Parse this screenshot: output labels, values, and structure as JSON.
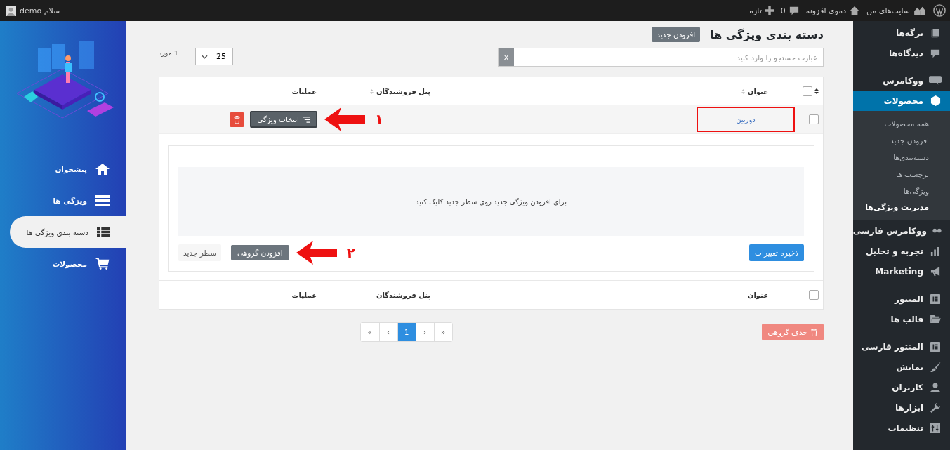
{
  "admin_bar": {
    "items": [
      {
        "kind": "wordpress"
      },
      {
        "kind": "sites",
        "label": "سایت‌های من"
      },
      {
        "kind": "home",
        "label": "دموی افزونه"
      },
      {
        "kind": "comments",
        "label": "0"
      },
      {
        "kind": "new",
        "label": "تازه"
      }
    ],
    "greeting": "سلام demo"
  },
  "admin_menu": {
    "groups": [
      [
        {
          "kind": "pages",
          "label": "برگه‌ها",
          "selected": false
        },
        {
          "kind": "comments",
          "label": "دیدگاه‌ها",
          "selected": false
        }
      ],
      [
        {
          "kind": "woo",
          "label": "ووکامرس",
          "selected": false
        },
        {
          "kind": "box",
          "label": "محصولات",
          "selected": true,
          "children": [
            {
              "label": "همه محصولات",
              "selected": false
            },
            {
              "label": "افزودن جدید",
              "selected": false
            },
            {
              "label": "دسته‌بندی‌ها",
              "selected": false
            },
            {
              "label": "برچسب ها",
              "selected": false
            },
            {
              "label": "ویژگی‌ها",
              "selected": false
            },
            {
              "label": "مدیریت ویژگی‌ها",
              "selected": true
            }
          ]
        },
        {
          "kind": "quote",
          "label": "ووکامرس فارسی",
          "selected": false
        },
        {
          "kind": "chart",
          "label": "تجربه و تحلیل",
          "selected": false
        },
        {
          "kind": "megaphone",
          "label": "Marketing",
          "selected": false
        }
      ],
      [
        {
          "kind": "elementor",
          "label": "المنتور",
          "selected": false
        },
        {
          "kind": "folder",
          "label": "قالب ها",
          "selected": false
        }
      ],
      [
        {
          "kind": "elementor",
          "label": "المنتور فارسی",
          "selected": false
        },
        {
          "kind": "brush",
          "label": "نمایش",
          "selected": false
        },
        {
          "kind": "user",
          "label": "کاربران",
          "selected": false
        },
        {
          "kind": "wrench",
          "label": "ابزارها",
          "selected": false
        },
        {
          "kind": "settings",
          "label": "تنظیمات",
          "selected": false
        }
      ]
    ]
  },
  "plugin_nav": {
    "items": [
      {
        "kind": "home",
        "label": "پیشخوان",
        "selected": false
      },
      {
        "kind": "rows",
        "label": "ویژگی ها",
        "selected": false
      },
      {
        "kind": "list",
        "label": "دسته بندی ویژگی ها",
        "selected": true
      },
      {
        "kind": "cart",
        "label": "محصولات",
        "selected": false
      }
    ]
  },
  "page": {
    "title": "دسته بندی ویژگی ها",
    "add_button": "افزودن جدید"
  },
  "search": {
    "placeholder": "عبارت جستجو را وارد کنید",
    "clear": "x"
  },
  "per_page": {
    "value": "25",
    "count": "1 مورد"
  },
  "table": {
    "select_all_checked": false,
    "footer_select_all_checked": false,
    "columns": [
      "عنوان",
      "پنل فروشندگان",
      "عملیات"
    ],
    "rows": [
      {
        "checked": false,
        "title": "دوربین",
        "highlighted": true,
        "select_button": "انتخاب ویژگی",
        "annotation": "۱",
        "expanded": true
      }
    ],
    "panel": {
      "empty_message": "برای افزودن ویژگی جدید روی سطر جدید کلیک کنید",
      "save_button": "ذخیره تغییرات",
      "bulk_add_button": "افزودن گروهی",
      "bulk_add_annotation": "۲",
      "new_row_button": "سطر جدید"
    },
    "footer_columns": [
      "عنوان",
      "پنل فروشندگان",
      "عملیات"
    ]
  },
  "bulk_delete": "حذف گروهی",
  "pagination": [
    {
      "label": "»",
      "selected": false
    },
    {
      "label": "›",
      "selected": false
    },
    {
      "label": "1",
      "selected": true
    },
    {
      "label": "‹",
      "selected": false
    },
    {
      "label": "«",
      "selected": false
    }
  ]
}
